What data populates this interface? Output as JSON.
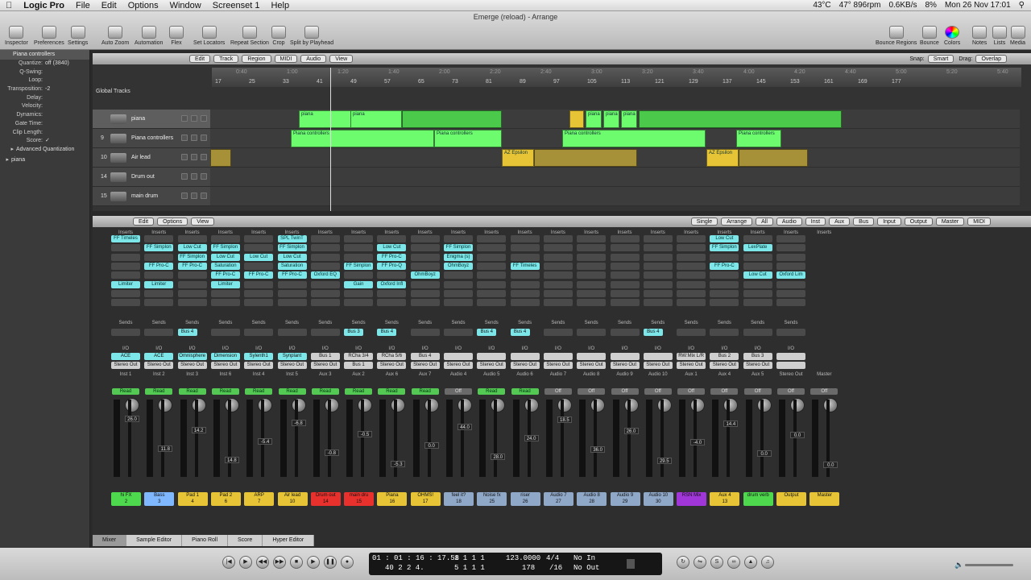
{
  "menubar": {
    "app": "Logic Pro",
    "items": [
      "File",
      "Edit",
      "Options",
      "Window",
      "Screenset 1",
      "Help"
    ],
    "status": {
      "temp": "43°C",
      "temp2": "601rpm",
      "fan": "47° 896rpm",
      "net_up": "0.6KB/s",
      "net_down": "0.1KB/s",
      "battery": "8%",
      "clock": "Mon 26 Nov  17:01"
    }
  },
  "window": {
    "title": "Emerge (reload) - Arrange"
  },
  "toolbar": {
    "left": [
      "Inspector",
      "Preferences",
      "Settings",
      "Auto Zoom",
      "Automation",
      "Flex",
      "Set Locators",
      "Repeat Section",
      "Crop",
      "Split by Playhead"
    ],
    "right": [
      "Bounce Regions",
      "Bounce",
      "Colors",
      "Notes",
      "Lists",
      "Media"
    ]
  },
  "inspector": {
    "header": "Piana controllers",
    "params": [
      [
        "Quantize:",
        "off (3840)"
      ],
      [
        "Q-Swing:",
        ""
      ],
      [
        "Loop:",
        ""
      ],
      [
        "Transposition:",
        "-2"
      ],
      [
        "Delay:",
        ""
      ],
      [
        "Velocity:",
        ""
      ],
      [
        "Dynamics:",
        ""
      ],
      [
        "Gate Time:",
        ""
      ],
      [
        "Clip Length:",
        ""
      ],
      [
        "Score:",
        "✓"
      ]
    ],
    "advanced": "Advanced Quantization",
    "region": "piana"
  },
  "arrange": {
    "menus": [
      "Edit",
      "Track",
      "Region",
      "MIDI",
      "Audio",
      "View"
    ],
    "snap_label": "Snap:",
    "snap": "Smart",
    "drag_label": "Drag:",
    "drag": "Overlap",
    "global": "Global Tracks",
    "bars": [
      "17",
      "25",
      "33",
      "41",
      "49",
      "57",
      "65",
      "73",
      "81",
      "89",
      "97",
      "105",
      "113",
      "121",
      "129",
      "137",
      "145",
      "153",
      "161",
      "169",
      "177"
    ],
    "times": [
      "0:40",
      "1:00",
      "1:20",
      "1:40",
      "2:00",
      "2:20",
      "2:40",
      "3:00",
      "3:20",
      "3:40",
      "4:00",
      "4:20",
      "4:40",
      "5:00",
      "5:20",
      "5:40"
    ],
    "tracks": [
      {
        "num": "",
        "name": "piana"
      },
      {
        "num": "9",
        "name": "Piana controllers"
      },
      {
        "num": "10",
        "name": "Air lead"
      },
      {
        "num": "14",
        "name": "Drum out"
      },
      {
        "num": "15",
        "name": "main drum"
      }
    ],
    "region_labels": {
      "piana": "piana",
      "ctrl": "Piana controllers",
      "az": "AZ Epsilon"
    }
  },
  "mixer": {
    "menus": [
      "Edit",
      "Options",
      "View"
    ],
    "views": [
      "Single",
      "Arrange",
      "All"
    ],
    "filters": [
      "Audio",
      "Inst",
      "Aux",
      "Bus",
      "Input",
      "Output",
      "Master",
      "MIDI"
    ],
    "labels": {
      "inserts": "Inserts",
      "sends": "Sends",
      "io": "I/O"
    },
    "strips": [
      {
        "inserts": [
          "FF Timeles",
          "",
          "",
          "",
          "",
          "Limiter"
        ],
        "send": "",
        "in": "ACE",
        "out": "Stereo Out",
        "ch": "Inst 1",
        "auto": "Read",
        "val": "26.0",
        "name": "hi FX",
        "num": "2",
        "color": "#4ed84e"
      },
      {
        "inserts": [
          "",
          "FF Simplon",
          "",
          "FF Pro-C",
          "",
          "Limiter"
        ],
        "send": "",
        "in": "ACE",
        "out": "Stereo Out",
        "ch": "Inst 2",
        "auto": "Read",
        "val": "11.8",
        "name": "Bass",
        "num": "3",
        "color": "#7fb8ff"
      },
      {
        "inserts": [
          "",
          "Low Cut",
          "FF Simplon",
          "FF Pro-C",
          "",
          ""
        ],
        "send": "Bus 4",
        "in": "Omnisphere",
        "out": "Stereo Out",
        "ch": "Inst 3",
        "auto": "Read",
        "val": "14.2",
        "name": "Pad 1",
        "num": "4",
        "color": "#e6c436"
      },
      {
        "inserts": [
          "",
          "FF Simplon",
          "Low Cut",
          "Saturation",
          "FF Pro-C",
          "Limiter"
        ],
        "send": "",
        "in": "Dimension",
        "out": "Stereo Out",
        "ch": "Inst 6",
        "auto": "Read",
        "val": "14.8",
        "name": "Pad 2",
        "num": "6",
        "color": "#e6c436"
      },
      {
        "inserts": [
          "",
          "",
          "Low Cut",
          "",
          "FF Pro-C",
          ""
        ],
        "send": "",
        "in": "Sylenth1",
        "out": "Stereo Out",
        "ch": "Inst 4",
        "auto": "Read",
        "val": "-5.4",
        "name": "ARP",
        "num": "7",
        "color": "#e6c436"
      },
      {
        "inserts": [
          "SPL TwinT",
          "FF Simplon",
          "Low Cut",
          "Saturation",
          "FF Pro-C",
          ""
        ],
        "send": "",
        "in": "Synplant",
        "out": "Stereo Out",
        "ch": "Inst 5",
        "auto": "Read",
        "val": "-6.8",
        "name": "Air lead",
        "num": "10",
        "color": "#e6c436"
      },
      {
        "inserts": [
          "",
          "",
          "",
          "",
          "Oxford EQ",
          ""
        ],
        "send": "",
        "in": "Bus 1",
        "out": "Stereo Out",
        "ch": "Aux 3",
        "auto": "Read",
        "val": "-0.8",
        "name": "Drum out",
        "num": "14",
        "color": "#e8312c"
      },
      {
        "inserts": [
          "",
          "",
          "",
          "FF Simplon",
          "",
          "Gain"
        ],
        "send": "Bus 3",
        "in": "RCha 3/4",
        "out": "Bus 1",
        "ch": "Aux 2",
        "auto": "Read",
        "val": "-0.5",
        "name": "main dru",
        "num": "15",
        "color": "#e8312c"
      },
      {
        "inserts": [
          "",
          "Low Cut",
          "FF Pro-C",
          "FF Pro-Q",
          "",
          "Oxford Infl"
        ],
        "send": "Bus 4",
        "in": "RCha 5/6",
        "out": "Stereo Out",
        "ch": "Aux 6",
        "auto": "Read",
        "val": "-5.3",
        "name": "Piana",
        "num": "16",
        "color": "#e6c436"
      },
      {
        "inserts": [
          "",
          "",
          "",
          "",
          "OhmBoyz",
          ""
        ],
        "send": "",
        "in": "Bus 4",
        "out": "Stereo Out",
        "ch": "Aux 7",
        "auto": "Read",
        "val": "0.0",
        "name": "OHMS!",
        "num": "17",
        "color": "#e6c436"
      },
      {
        "inserts": [
          "",
          "FF Simplon",
          "Enigma (s)",
          "OhmBoyz",
          "",
          ""
        ],
        "send": "",
        "in": "",
        "out": "Stereo Out",
        "ch": "Audio 4",
        "auto": "Off",
        "val": "44.0",
        "name": "feel it?",
        "num": "18",
        "color": "#8fa8c8"
      },
      {
        "inserts": [
          "",
          "",
          "",
          "",
          "",
          ""
        ],
        "send": "Bus 4",
        "in": "",
        "out": "Stereo Out",
        "ch": "Audio 5",
        "auto": "Read",
        "val": "28.0",
        "name": "Noise fx",
        "num": "25",
        "color": "#8fa8c8"
      },
      {
        "inserts": [
          "",
          "",
          "",
          "FF Timeles",
          "",
          ""
        ],
        "send": "Bus 4",
        "in": "",
        "out": "Stereo Out",
        "ch": "Audio 6",
        "auto": "Read",
        "val": "24.0",
        "name": "riser",
        "num": "26",
        "color": "#8fa8c8"
      },
      {
        "inserts": [
          "",
          "",
          "",
          "",
          "",
          ""
        ],
        "send": "",
        "in": "",
        "out": "Stereo Out",
        "ch": "Audio 7",
        "auto": "Off",
        "val": "18.5",
        "name": "Audio 7",
        "num": "27",
        "color": "#8fa8c8"
      },
      {
        "inserts": [
          "",
          "",
          "",
          "",
          "",
          ""
        ],
        "send": "",
        "in": "",
        "out": "Stereo Out",
        "ch": "Audio 8",
        "auto": "Off",
        "val": "36.0",
        "name": "Audio 8",
        "num": "28",
        "color": "#8fa8c8"
      },
      {
        "inserts": [
          "",
          "",
          "",
          "",
          "",
          ""
        ],
        "send": "",
        "in": "",
        "out": "Stereo Out",
        "ch": "Audio 9",
        "auto": "Off",
        "val": "26.0",
        "name": "Audio 9",
        "num": "29",
        "color": "#8fa8c8"
      },
      {
        "inserts": [
          "",
          "",
          "",
          "",
          "",
          ""
        ],
        "send": "Bus 4",
        "in": "",
        "out": "Stereo Out",
        "ch": "Audio 10",
        "auto": "Off",
        "val": "29.5",
        "name": "Audio 10",
        "num": "30",
        "color": "#8fa8c8"
      },
      {
        "inserts": [
          "",
          "",
          "",
          "",
          "",
          ""
        ],
        "send": "",
        "in": "RW:Mix L/R",
        "out": "Stereo Out",
        "ch": "Aux 1",
        "auto": "Off",
        "val": "-4.0",
        "name": "RSN Mix",
        "num": "",
        "color": "#a036d8"
      },
      {
        "inserts": [
          "Low Cut",
          "FF Simplon",
          "",
          "FF Pro-C",
          "",
          ""
        ],
        "send": "",
        "in": "Bus 2",
        "out": "Stereo Out",
        "ch": "Aux 4",
        "auto": "Off",
        "val": "14.4",
        "name": "Aux 4",
        "num": "13",
        "color": "#e6c436"
      },
      {
        "inserts": [
          "",
          "LexPlate",
          "",
          "",
          "Low Cut",
          ""
        ],
        "send": "",
        "in": "Bus 3",
        "out": "Stereo Out",
        "ch": "Aux 5",
        "auto": "Off",
        "val": "0.0",
        "name": "drum verb",
        "num": "",
        "color": "#4ed84e"
      },
      {
        "inserts": [
          "",
          "",
          "",
          "",
          "Oxford Lim",
          ""
        ],
        "send": "",
        "in": "",
        "out": "",
        "ch": "Stereo Out",
        "auto": "Off",
        "val": "0.0",
        "name": "Output",
        "num": "",
        "color": "#e6c436"
      },
      {
        "inserts": [],
        "send": "",
        "in": "",
        "out": "",
        "ch": "Master",
        "auto": "Off",
        "val": "0.0",
        "name": "Master",
        "num": "",
        "color": "#e6c436"
      }
    ]
  },
  "bottom_tabs": [
    "Mixer",
    "Sample Editor",
    "Piano Roll",
    "Score",
    "Hyper Editor"
  ],
  "transport": {
    "time": "01 : 01 : 16 : 17.58",
    "subtime": "40   2   2   4.",
    "pos": "1   1   1   1",
    "pos2": "5   1   1   1",
    "tempo": "123.0000",
    "tempo2": "178",
    "sig": "4/4",
    "div": "/16",
    "in": "No In",
    "out": "No Out"
  }
}
